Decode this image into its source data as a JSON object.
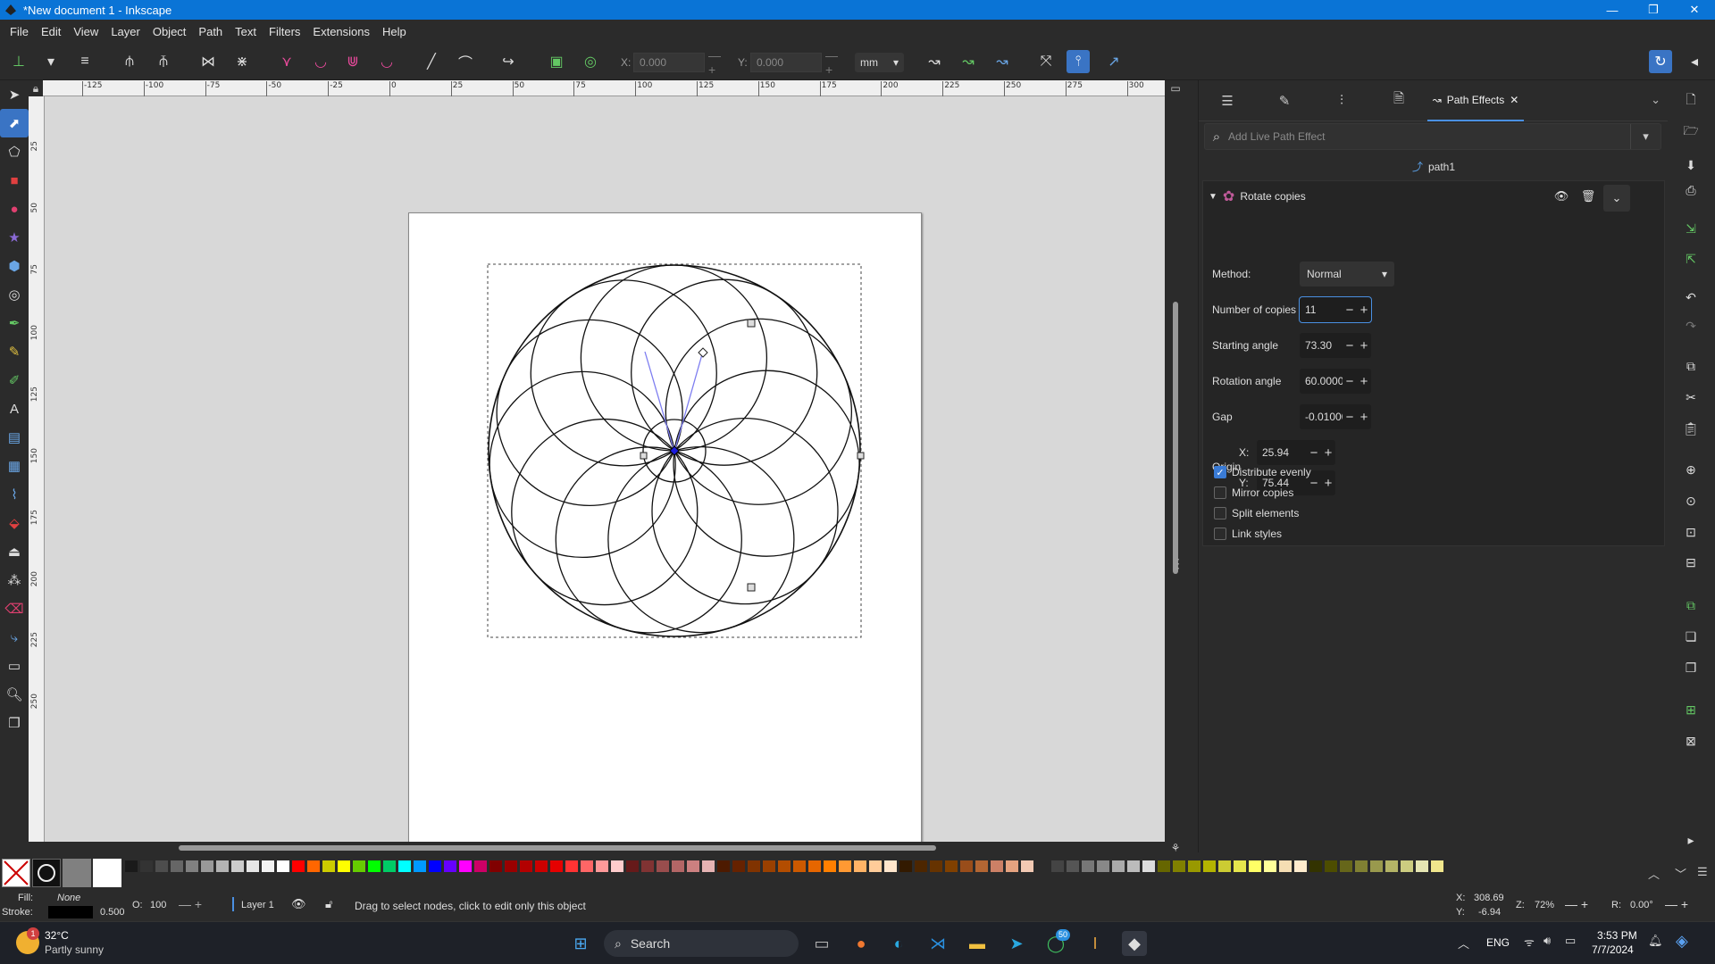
{
  "window": {
    "title": "*New document 1 - Inkscape",
    "minimize": "—",
    "maximize": "❐",
    "close": "✕"
  },
  "menu": [
    "File",
    "Edit",
    "View",
    "Layer",
    "Object",
    "Path",
    "Text",
    "Filters",
    "Extensions",
    "Help"
  ],
  "toolctl": {
    "x_label": "X:",
    "x_value": "0.000",
    "y_label": "Y:",
    "y_value": "0.000",
    "unit": "mm"
  },
  "ruler": {
    "h_ticks": [
      "-125",
      "-100",
      "-75",
      "-50",
      "-25",
      "0",
      "25",
      "50",
      "75",
      "100",
      "125",
      "150",
      "175",
      "200",
      "225",
      "250",
      "275",
      "300"
    ],
    "v_ticks": [
      "25",
      "50",
      "75",
      "100",
      "125",
      "150",
      "175",
      "200",
      "225",
      "250"
    ]
  },
  "dock": {
    "active_tab": "Path Effects",
    "search_placeholder": "Add Live Path Effect",
    "path_name": "path1",
    "effect": {
      "name": "Rotate copies",
      "method_label": "Method:",
      "method_value": "Normal",
      "copies_label": "Number of copies",
      "copies_value": "11",
      "start_label": "Starting angle",
      "start_value": "73.30",
      "rot_label": "Rotation angle",
      "rot_value": "60.0000",
      "gap_label": "Gap",
      "gap_value": "-0.01000",
      "origin_label": "Origin",
      "ox_label": "X:",
      "ox_value": "25.94",
      "oy_label": "Y:",
      "oy_value": "75.44",
      "checks": [
        {
          "label": "Distribute evenly",
          "checked": true
        },
        {
          "label": "Mirror copies",
          "checked": false
        },
        {
          "label": "Split elements",
          "checked": false
        },
        {
          "label": "Link styles",
          "checked": false
        }
      ]
    }
  },
  "status": {
    "fill_label": "Fill:",
    "fill_value": "None",
    "stroke_label": "Stroke:",
    "stroke_width": "0.500",
    "opacity_label": "O:",
    "opacity_value": "100",
    "layer": "Layer 1",
    "message": "Drag to select nodes, click to edit only this object",
    "cx_label": "X:",
    "cx_value": "308.69",
    "cy_label": "Y:",
    "cy_value": "-6.94",
    "zoom_label": "Z:",
    "zoom_value": "72%",
    "rot_label": "R:",
    "rot_value": "0.00°"
  },
  "taskbar": {
    "temp": "32°C",
    "weather": "Partly sunny",
    "weather_badge": "1",
    "search": "Search",
    "lang": "ENG",
    "time": "3:53 PM",
    "date": "7/7/2024",
    "whatsapp_badge": "50"
  },
  "colors": {
    "accent": "#0a74d6",
    "active_tool": "#3a74c4",
    "tab_underline": "#4a90e2"
  }
}
